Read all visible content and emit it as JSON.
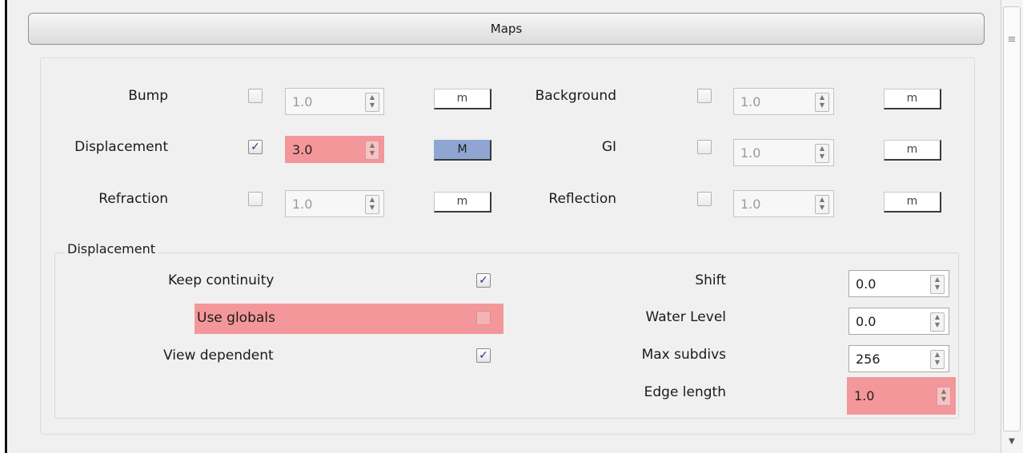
{
  "header": {
    "title": "Maps"
  },
  "maps": [
    {
      "label": "Bump",
      "checked": false,
      "value": "1.0",
      "button": "m",
      "active": false
    },
    {
      "label": "Displacement",
      "checked": true,
      "value": "3.0",
      "button": "M",
      "active": true
    },
    {
      "label": "Refraction",
      "checked": false,
      "value": "1.0",
      "button": "m",
      "active": false
    },
    {
      "label": "Background",
      "checked": false,
      "value": "1.0",
      "button": "m",
      "active": false
    },
    {
      "label": "GI",
      "checked": false,
      "value": "1.0",
      "button": "m",
      "active": false
    },
    {
      "label": "Reflection",
      "checked": false,
      "value": "1.0",
      "button": "m",
      "active": false
    }
  ],
  "displacement": {
    "title": "Displacement",
    "options": [
      {
        "label": "Keep continuity",
        "checked": true
      },
      {
        "label": "Use globals",
        "checked": false
      },
      {
        "label": "View dependent",
        "checked": true
      }
    ],
    "fields": [
      {
        "label": "Shift",
        "value": "0.0"
      },
      {
        "label": "Water Level",
        "value": "0.0"
      },
      {
        "label": "Max subdivs",
        "value": "256"
      },
      {
        "label": "Edge length",
        "value": "1.0"
      }
    ]
  },
  "icons": {
    "check": "✓",
    "spin_up": "▲",
    "spin_down": "▼",
    "scroll_grip": "≡",
    "scroll_down": "▼"
  },
  "colors": {
    "highlight": "#f4979a",
    "active_button": "#8ea6d1"
  }
}
